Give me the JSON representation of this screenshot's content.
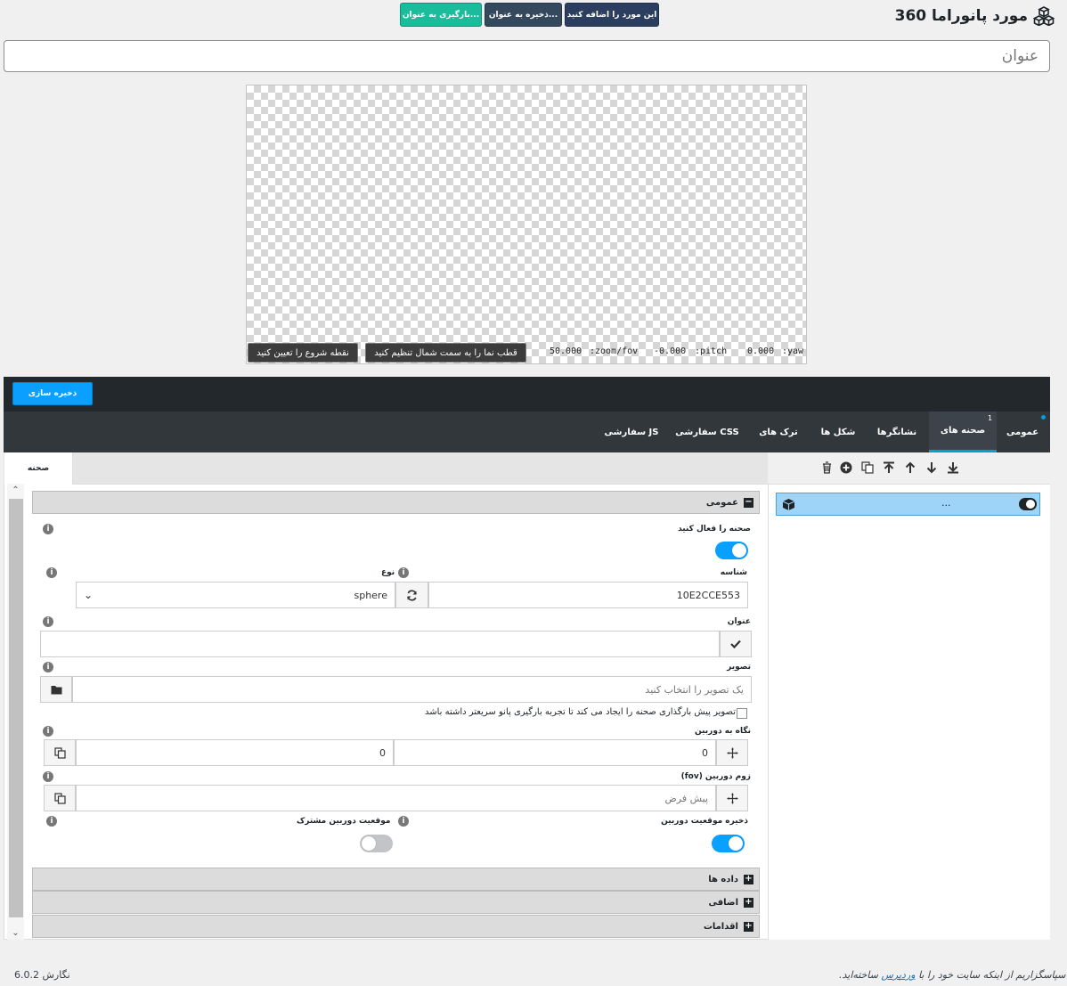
{
  "header": {
    "title": "مورد پانوراما 360",
    "icon": "cubes-icon",
    "buttons": {
      "add": "این مورد را اضافه کنید",
      "save_as": "ذخیره به عنوان...",
      "load_as": "بارگیری به عنوان..."
    },
    "title_placeholder": "عنوان"
  },
  "preview": {
    "set_start_button": "نقطه شروع را تعیین کنید",
    "set_north_button": "قطب نما را به سمت شمال تنظیم کنید",
    "zoom_label": ":zoom/fov",
    "zoom_value": "50.000",
    "pitch_label": ":pitch",
    "pitch_value": "-0.000",
    "yaw_label": ":yaw",
    "yaw_value": "0.000"
  },
  "toolbar": {
    "save_button": "ذخیره سازی"
  },
  "tabs": [
    {
      "label": "عمومی",
      "active": false
    },
    {
      "label": "صحنه های",
      "active": true,
      "badge": "1"
    },
    {
      "label": "نشانگرها",
      "active": false
    },
    {
      "label": "شکل ها",
      "active": false
    },
    {
      "label": "ترک های",
      "active": false
    },
    {
      "label": "CSS سفارشی",
      "active": false
    },
    {
      "label": "JS سفارشی",
      "active": false
    }
  ],
  "scene_panel": {
    "tab_label": "صحنه",
    "sections": {
      "general": "عمومی",
      "data": "داده ها",
      "extra": "اضافی",
      "actions": "اقدامات"
    },
    "enable_scene_label": "صحنه را فعال کنید",
    "enable_scene": true,
    "id_label": "شناسه",
    "id_value": "10E2CCE553",
    "type_label": "نوع",
    "type_value": "sphere",
    "title_label": "عنوان",
    "title_value": "",
    "image_label": "تصویر",
    "image_placeholder": "یک تصویر را انتخاب کنید",
    "preload_text": "تصویر پیش بارگذاری صحنه را ایجاد می کند تا تجربه بارگیری پانو سریعتر داشته باشد",
    "camera_look_label": "نگاه به دوربین",
    "camera_look_x": "0",
    "camera_look_y": "0",
    "camera_zoom_label": "زوم دوربین (fov)",
    "camera_zoom_placeholder": "پیش فرض",
    "save_camera_label": "ذخیره موقعیت دوربین",
    "save_camera": true,
    "shared_camera_label": "موقعیت دوربین مشترک",
    "shared_camera": false
  },
  "scenes_list": {
    "items": [
      {
        "label": "..."
      }
    ]
  },
  "footer": {
    "thanks_prefix": "سپاسگزاریم از اینکه سایت خود را با",
    "wordpress": "وردپرس",
    "thanks_suffix": "ساخته‌اید.",
    "version": "نگارش 6.0.2"
  },
  "colors": {
    "accent": "#0aa0ff",
    "dark_bar": "#23282d",
    "tab_bar": "#32373c",
    "selected_item": "#9dd4f8"
  }
}
